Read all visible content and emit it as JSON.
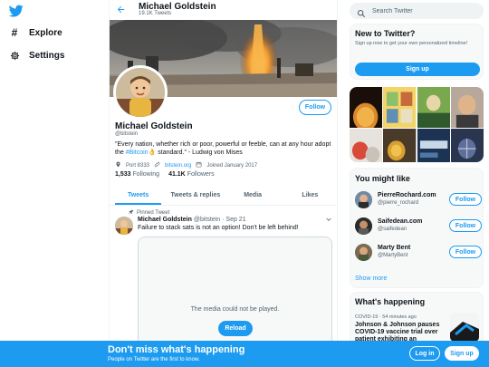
{
  "colors": {
    "accent": "#1d9bf0",
    "text": "#0f1419",
    "muted": "#536471"
  },
  "nav": {
    "logo_icon": "twitter-bird-icon",
    "items": [
      {
        "label": "Explore",
        "icon": "hashtag-icon"
      },
      {
        "label": "Settings",
        "icon": "gear-icon"
      }
    ]
  },
  "header": {
    "name": "Michael Goldstein",
    "tweet_count": "19.1K Tweets"
  },
  "profile": {
    "name": "Michael Goldstein",
    "handle": "@bitstein",
    "follow_label": "Follow",
    "bio_before": "\"Every nation, whether rich or poor, powerful or feeble, can at any hour adopt the ",
    "bio_link": "#Bitcoin",
    "bio_emoji": "👌",
    "bio_after": " standard.\" - Ludwig von Mises",
    "location": "Port 8333",
    "website": "bitstein.org",
    "joined": "Joined January 2017",
    "following_count": "1,533",
    "following_label": "Following",
    "followers_count": "41.1K",
    "followers_label": "Followers"
  },
  "tabs": [
    {
      "label": "Tweets",
      "active": true
    },
    {
      "label": "Tweets & replies",
      "active": false
    },
    {
      "label": "Media",
      "active": false
    },
    {
      "label": "Likes",
      "active": false
    }
  ],
  "tweet": {
    "pinned_label": "Pinned Tweet",
    "author": "Michael Goldstein",
    "handle": "@bitstein",
    "date": "Sep 21",
    "text": "Failure to stack sats is not an option! Don't be left behind!",
    "media_message": "The media could not be played.",
    "reload_label": "Reload"
  },
  "search": {
    "placeholder": "Search Twitter"
  },
  "new_to_twitter": {
    "title": "New to Twitter?",
    "description": "Sign up now to get your own personalized timeline!",
    "signup_label": "Sign up"
  },
  "you_might_like": {
    "title": "You might like",
    "accounts": [
      {
        "name": "PierreRochard.com",
        "handle": "@pierre_rochard",
        "follow_label": "Follow"
      },
      {
        "name": "Saifedean.com",
        "handle": "@saifedean",
        "follow_label": "Follow"
      },
      {
        "name": "Marty Bent",
        "handle": "@MartyBent",
        "follow_label": "Follow"
      }
    ],
    "show_more": "Show more"
  },
  "whats_happening": {
    "title": "What's happening",
    "meta": "COVID-19 · 54 minutes ago",
    "headline": "Johnson & Johnson pauses COVID-19 vaccine trial over patient exhibiting an"
  },
  "bottom_bar": {
    "title": "Don't miss what's happening",
    "subtitle": "People on Twitter are the first to know.",
    "login_label": "Log in",
    "signup_label": "Sign up"
  }
}
